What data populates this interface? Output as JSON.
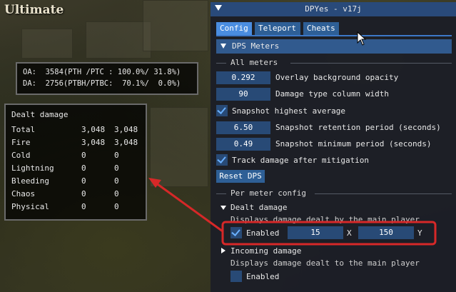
{
  "game": {
    "title": "Ultimate",
    "stats_lines": [
      "OA:  3584(PTH /PTC : 100.0%/ 31.8%)",
      "DA:  2756(PTBH/PTBC:  70.1%/  0.0%)"
    ],
    "damage_overlay": {
      "title": "Dealt damage",
      "rows": [
        {
          "name": "Total",
          "v1": "3,048",
          "v2": "3,048"
        },
        {
          "name": "Fire",
          "v1": "3,048",
          "v2": "3,048"
        },
        {
          "name": "Cold",
          "v1": "0",
          "v2": "0"
        },
        {
          "name": "Lightning",
          "v1": "0",
          "v2": "0"
        },
        {
          "name": "Bleeding",
          "v1": "0",
          "v2": "0"
        },
        {
          "name": "Chaos",
          "v1": "0",
          "v2": "0"
        },
        {
          "name": "Physical",
          "v1": "0",
          "v2": "0"
        }
      ]
    }
  },
  "window": {
    "title": "DPYes - v17j",
    "tabs": [
      "Config",
      "Teleport",
      "Cheats"
    ],
    "header": "DPS Meters",
    "all_meters_label": "All meters",
    "opacity_value": "0.292",
    "opacity_label": "Overlay background opacity",
    "column_width_value": "90",
    "column_width_label": "Damage type column width",
    "snapshot_highest_label": "Snapshot highest average",
    "retention_value": "6.50",
    "retention_label": "Snapshot retention period (seconds)",
    "minimum_value": "0.49",
    "minimum_label": "Snapshot minimum period (seconds)",
    "track_label": "Track damage after mitigation",
    "reset_label": "Reset DPS",
    "per_meter_label": "Per meter config",
    "dealt": {
      "title": "Dealt damage",
      "desc": "Displays damage dealt by the main player",
      "enabled_label": "Enabled",
      "x_value": "15",
      "x_label": "X",
      "y_value": "150",
      "y_label": "Y"
    },
    "incoming": {
      "title": "Incoming damage",
      "desc": "Displays damage dealt to the main player",
      "enabled_label": "Enabled"
    }
  },
  "colors": {
    "title_bar": "#294a7a",
    "tab_active": "#4a8de0",
    "field_bg": "#284a76",
    "highlight": "#d62828"
  }
}
